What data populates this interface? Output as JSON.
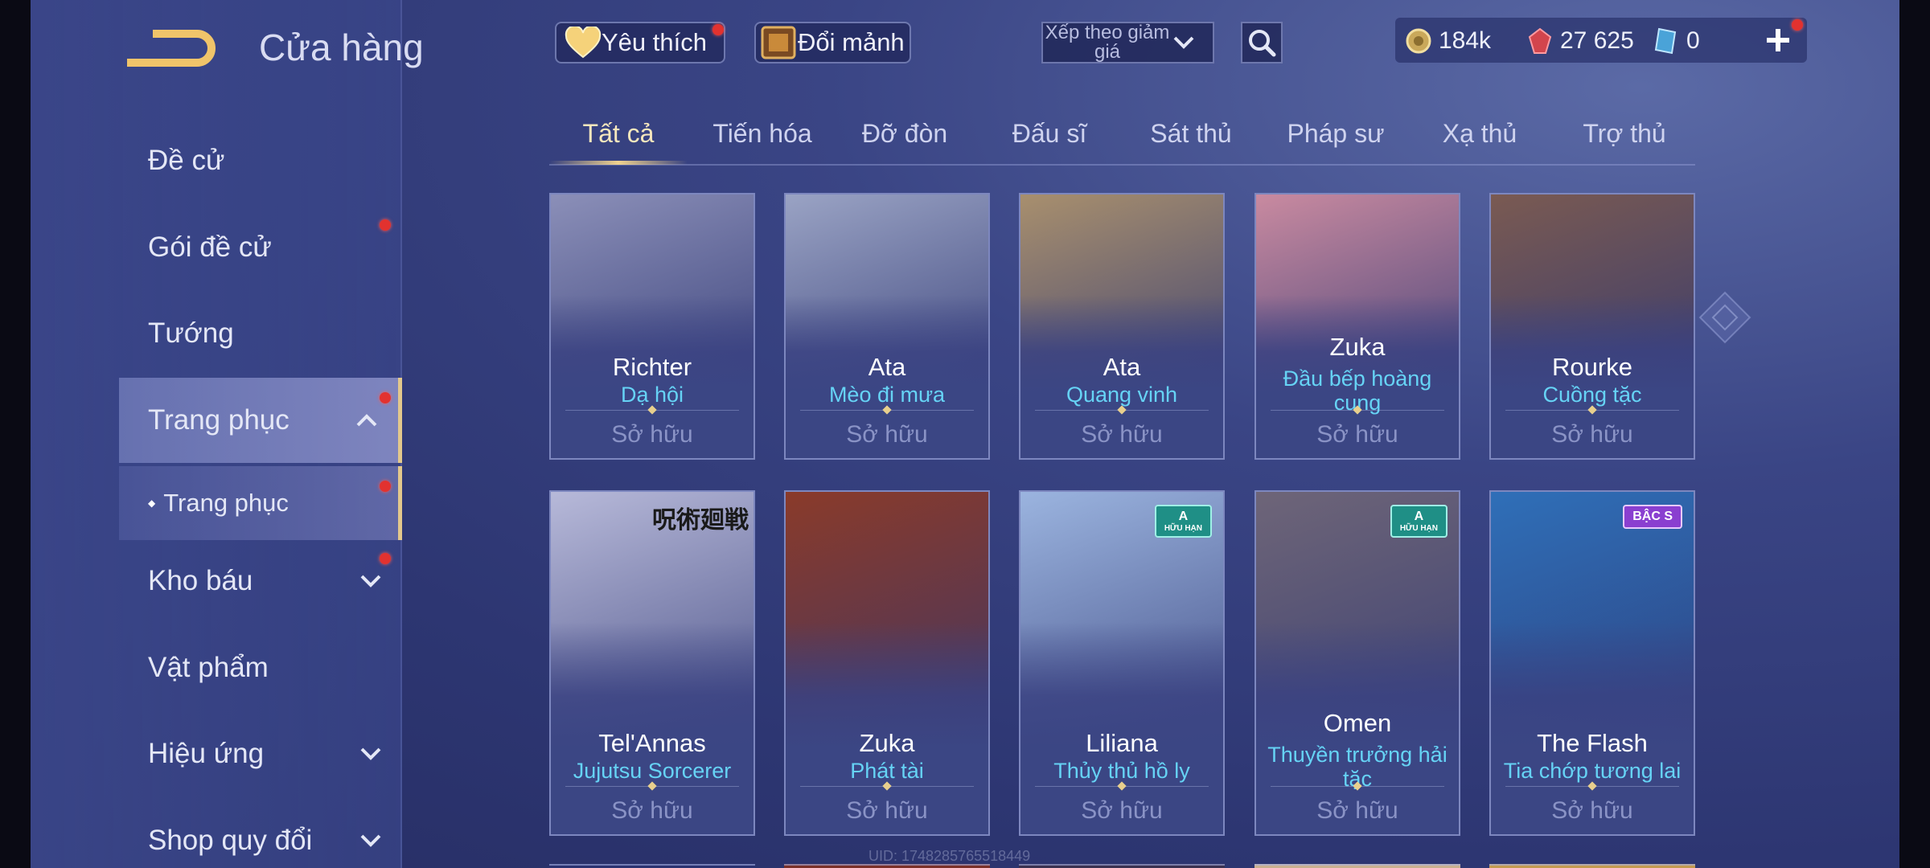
{
  "header": {
    "title": "Cửa hàng",
    "favorites_label": "Yêu thích",
    "exchange_label": "Đổi mảnh",
    "sort_label": "Xếp theo giảm giá",
    "currencies": [
      {
        "name": "gold-coin",
        "value": "184k"
      },
      {
        "name": "ruby",
        "value": "27 625"
      },
      {
        "name": "voucher",
        "value": "0"
      }
    ]
  },
  "sidebar": {
    "items": [
      {
        "label": "Đề cử"
      },
      {
        "label": "Gói đề cử"
      },
      {
        "label": "Tướng"
      },
      {
        "label": "Trang phục"
      },
      {
        "label": "Trang phục"
      },
      {
        "label": "Kho báu"
      },
      {
        "label": "Vật phẩm"
      },
      {
        "label": "Hiệu ứng"
      },
      {
        "label": "Shop quy đổi"
      }
    ]
  },
  "tabs": [
    {
      "label": "Tất cả"
    },
    {
      "label": "Tiến hóa"
    },
    {
      "label": "Đỡ đòn"
    },
    {
      "label": "Đấu sĩ"
    },
    {
      "label": "Sát thủ"
    },
    {
      "label": "Pháp sư"
    },
    {
      "label": "Xạ thủ"
    },
    {
      "label": "Trợ thủ"
    }
  ],
  "cards": [
    {
      "hero": "Richter",
      "skin": "Dạ hội",
      "status": "Sở hữu",
      "bg": "#8b8fb8"
    },
    {
      "hero": "Ata",
      "skin": "Mèo đi mưa",
      "status": "Sở hữu",
      "bg": "#9aa3c4"
    },
    {
      "hero": "Ata",
      "skin": "Quang vinh",
      "status": "Sở hữu",
      "bg": "#a88f6e"
    },
    {
      "hero": "Zuka",
      "skin": "Đầu bếp hoàng cung",
      "status": "Sở hữu",
      "bg": "#c98aa0"
    },
    {
      "hero": "Rourke",
      "skin": "Cuồng tặc",
      "status": "Sở hữu",
      "bg": "#7a5a52"
    },
    {
      "hero": "Tel'Annas",
      "skin": "Jujutsu Sorcerer",
      "status": "Sở hữu",
      "bg": "#b7b9d9",
      "corner_text": "呪術廻戦"
    },
    {
      "hero": "Zuka",
      "skin": "Phát tài",
      "status": "Sở hữu",
      "bg": "#8a3a2a"
    },
    {
      "hero": "Liliana",
      "skin": "Thủy thủ hồ ly",
      "status": "Sở hữu",
      "bg": "#9bb4df",
      "badge": "A",
      "badge_sub": "HỮU HẠN"
    },
    {
      "hero": "Omen",
      "skin": "Thuyền trưởng hải tặc",
      "status": "Sở hữu",
      "bg": "#6e6578",
      "badge": "A",
      "badge_sub": "HỮU HẠN"
    },
    {
      "hero": "The Flash",
      "skin": "Tia chớp tương lai",
      "status": "Sở hữu",
      "bg": "#2f6fb8",
      "badge": "BẬC S"
    }
  ],
  "footer": {
    "uid": "UID: 1748285765518449"
  }
}
